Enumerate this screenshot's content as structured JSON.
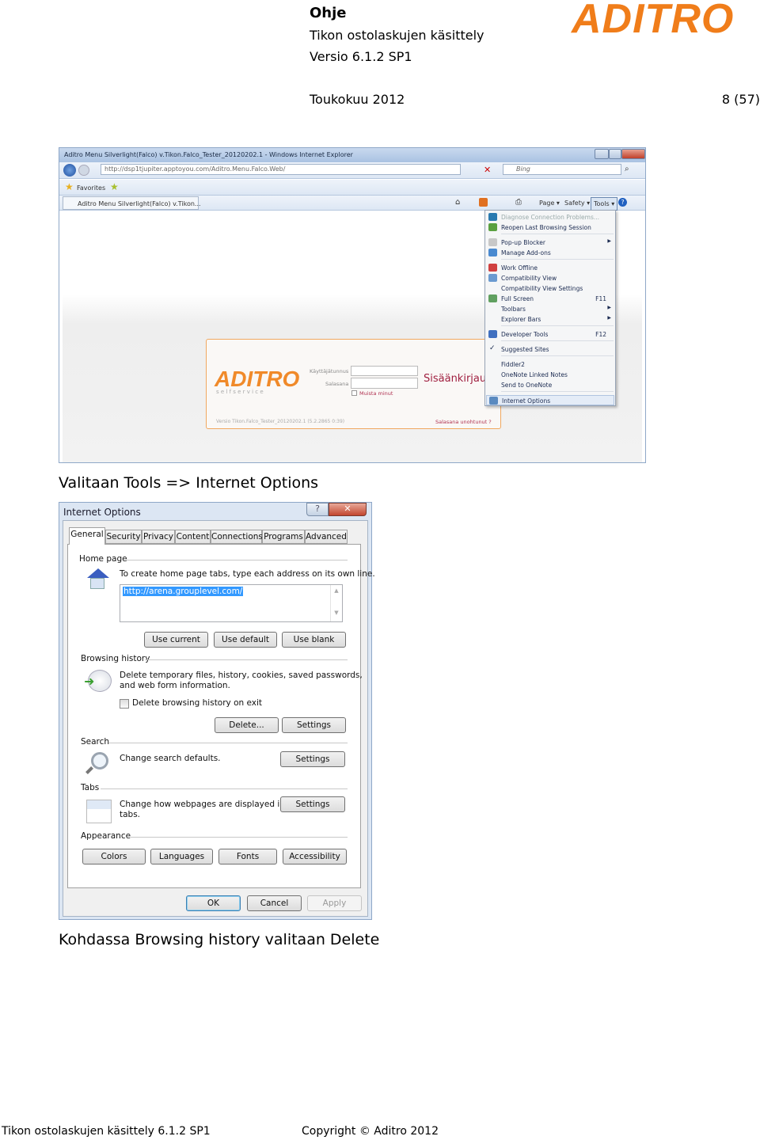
{
  "header": {
    "doc_type": "Ohje",
    "title": "Tikon ostolaskujen käsittely",
    "version": "Versio 6.1.2 SP1",
    "date": "Toukokuu 2012",
    "page": "8 (57)",
    "logo": "ADITRO",
    "brand_color": "#f07d1a"
  },
  "ie": {
    "window_title": "Aditro Menu Silverlight(Falco) v.Tikon.Falco_Tester_20120202.1 - Windows Internet Explorer",
    "url": "http://dsp1tjupiter.apptoyou.com/Aditro.Menu.Falco.Web/",
    "search_placeholder": "Bing",
    "favorites": "Favorites",
    "tab_title": "Aditro Menu Silverlight(Falco) v.Tikon...",
    "commands": {
      "page": "Page ▾",
      "safety": "Safety ▾",
      "tools": "Tools ▾"
    },
    "login": {
      "logo": "ADITRO",
      "tagline": "s e l f   s e r v i c e",
      "user_label": "Käyttäjätunnus",
      "password_label": "Salasana",
      "remember": "Muista minut",
      "heading": "Sisäänkirjau",
      "version": "Versio Tikon.Falco_Tester_20120202.1 (5.2.2865 0:39)",
      "forgot": "Salasana unohtunut ?"
    },
    "tools_menu": [
      {
        "label": "Diagnose Connection Problems...",
        "disabled": true
      },
      {
        "label": "Reopen Last Browsing Session"
      },
      {
        "label": "Pop-up Blocker",
        "submenu": true
      },
      {
        "label": "Manage Add-ons"
      },
      {
        "label": "Work Offline"
      },
      {
        "label": "Compatibility View"
      },
      {
        "label": "Compatibility View Settings"
      },
      {
        "label": "Full Screen",
        "shortcut": "F11"
      },
      {
        "label": "Toolbars",
        "submenu": true
      },
      {
        "label": "Explorer Bars",
        "submenu": true
      },
      {
        "label": "Developer Tools",
        "shortcut": "F12"
      },
      {
        "label": "Suggested Sites",
        "checked": true
      },
      {
        "label": "Fiddler2"
      },
      {
        "label": "OneNote Linked Notes"
      },
      {
        "label": "Send to OneNote"
      },
      {
        "label": "Internet Options",
        "highlighted": true
      }
    ]
  },
  "caption1": "Valitaan Tools => Internet Options",
  "dialog": {
    "title": "Internet Options",
    "tabs": [
      "General",
      "Security",
      "Privacy",
      "Content",
      "Connections",
      "Programs",
      "Advanced"
    ],
    "home_page": {
      "label": "Home page",
      "hint": "To create home page tabs, type each address on its own line.",
      "value": "http://arena.grouplevel.com/",
      "buttons": [
        "Use current",
        "Use default",
        "Use blank"
      ]
    },
    "browsing_history": {
      "label": "Browsing history",
      "text1": "Delete temporary files, history, cookies, saved passwords,",
      "text2": "and web form information.",
      "checkbox": "Delete browsing history on exit",
      "checked": false,
      "delete": "Delete...",
      "settings": "Settings"
    },
    "search": {
      "label": "Search",
      "text": "Change search defaults.",
      "settings": "Settings"
    },
    "tabs_group": {
      "label": "Tabs",
      "text1": "Change how webpages are displayed in",
      "text2": "tabs.",
      "settings": "Settings"
    },
    "appearance": {
      "label": "Appearance",
      "buttons": [
        "Colors",
        "Languages",
        "Fonts",
        "Accessibility"
      ]
    },
    "footer": {
      "ok": "OK",
      "cancel": "Cancel",
      "apply": "Apply"
    }
  },
  "caption2": "Kohdassa Browsing history valitaan Delete",
  "footer": {
    "left": "Tikon ostolaskujen käsittely 6.1.2 SP1",
    "copyright": "Copyright © Aditro 2012"
  }
}
